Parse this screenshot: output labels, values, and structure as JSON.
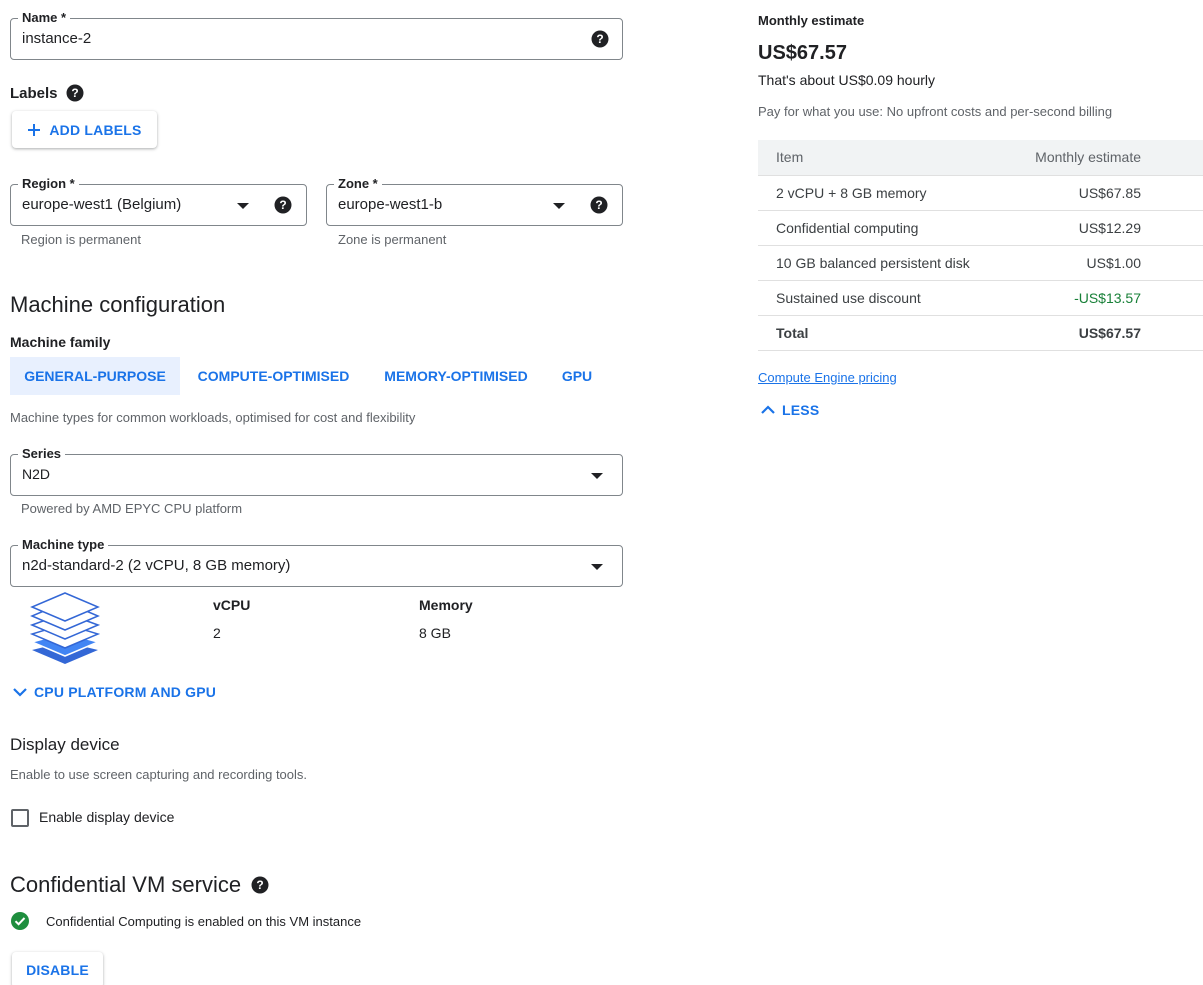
{
  "name_field": {
    "label": "Name *",
    "value": "instance-2"
  },
  "labels": {
    "title": "Labels",
    "add_button": "ADD LABELS"
  },
  "region": {
    "label": "Region *",
    "value": "europe-west1 (Belgium)",
    "hint": "Region is permanent"
  },
  "zone": {
    "label": "Zone *",
    "value": "europe-west1-b",
    "hint": "Zone is permanent"
  },
  "machine_config": {
    "title": "Machine configuration",
    "family_label": "Machine family",
    "tabs": [
      "GENERAL-PURPOSE",
      "COMPUTE-OPTIMISED",
      "MEMORY-OPTIMISED",
      "GPU"
    ],
    "family_description": "Machine types for common workloads, optimised for cost and flexibility",
    "series": {
      "label": "Series",
      "value": "N2D",
      "hint": "Powered by AMD EPYC CPU platform"
    },
    "machine_type": {
      "label": "Machine type",
      "value": "n2d-standard-2 (2 vCPU, 8 GB memory)"
    },
    "specs": {
      "vcpu_label": "vCPU",
      "vcpu_value": "2",
      "memory_label": "Memory",
      "memory_value": "8 GB"
    },
    "cpu_platform_toggle": "CPU PLATFORM AND GPU"
  },
  "display_device": {
    "title": "Display device",
    "description": "Enable to use screen capturing and recording tools.",
    "checkbox_label": "Enable display device"
  },
  "confidential_vm": {
    "title": "Confidential VM service",
    "status": "Confidential Computing is enabled on this VM instance",
    "disable_button": "DISABLE"
  },
  "estimate": {
    "heading": "Monthly estimate",
    "amount": "US$67.57",
    "hourly": "That's about US$0.09 hourly",
    "billing_note": "Pay for what you use: No upfront costs and per-second billing",
    "table": {
      "headers": [
        "Item",
        "Monthly estimate"
      ],
      "rows": [
        {
          "item": "2 vCPU + 8 GB memory",
          "cost": "US$67.85"
        },
        {
          "item": "Confidential computing",
          "cost": "US$12.29"
        },
        {
          "item": "10 GB balanced persistent disk",
          "cost": "US$1.00"
        },
        {
          "item": "Sustained use discount",
          "cost": "-US$13.57"
        }
      ],
      "total_label": "Total",
      "total_value": "US$67.57"
    },
    "pricing_link": "Compute Engine pricing",
    "less_toggle": "LESS"
  },
  "colors": {
    "accent": "#1a73e8",
    "tab_active_bg": "#e8f0fe",
    "discount": "#188038",
    "success": "#1e8e3e"
  }
}
